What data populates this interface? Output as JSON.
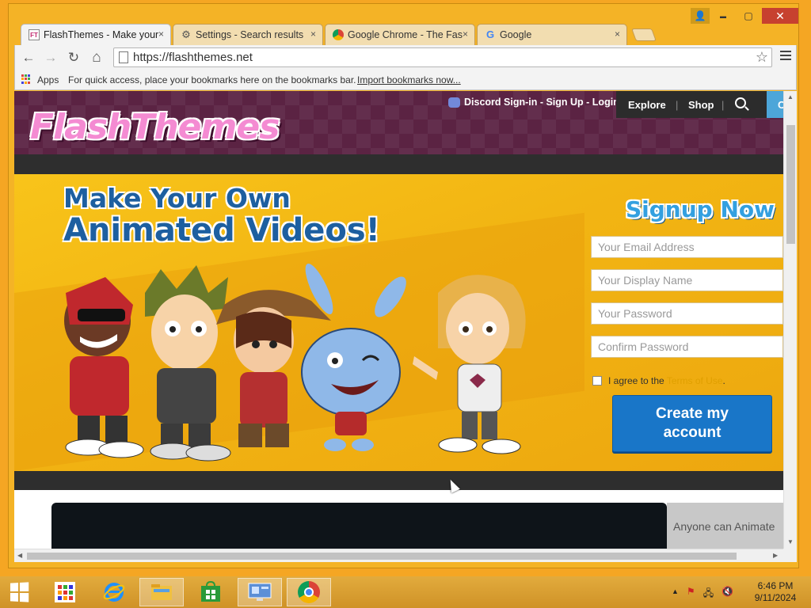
{
  "tabs": [
    {
      "label": "FlashThemes - Make your",
      "icon": "flashthemes-favicon",
      "close": "×"
    },
    {
      "label": "Settings - Search results",
      "icon": "gear-icon",
      "close": "×"
    },
    {
      "label": "Google Chrome - The Fas",
      "icon": "chrome-icon",
      "close": "×"
    },
    {
      "label": "Google",
      "icon": "google-icon",
      "close": "×"
    }
  ],
  "toolbar": {
    "url": "https://flashthemes.net",
    "back": "←",
    "forward": "→",
    "reload": "↻",
    "home": "⌂",
    "star": "☆"
  },
  "bookmarks": {
    "apps_label": "Apps",
    "hint": "For quick access, place your bookmarks here on the bookmarks bar.",
    "import_link": "Import bookmarks now..."
  },
  "site": {
    "logo": "FlashThemes",
    "discord_text": "Discord Sign-in - Sign Up - Login",
    "nav": {
      "explore": "Explore",
      "shop": "Shop",
      "sep": "|",
      "cta": "C"
    },
    "hero": {
      "line1": "Make Your Own",
      "line2": "Animated Videos!"
    },
    "signup": {
      "title": "Signup Now",
      "email_placeholder": "Your Email Address",
      "display_name_placeholder": "Your Display Name",
      "password_placeholder": "Your Password",
      "confirm_placeholder": "Confirm Password",
      "agree_prefix": "I agree to the",
      "terms_link": "Terms of Use",
      "agree_suffix": ".",
      "create_line1": "Create my",
      "create_line2": "account"
    },
    "video_side_text": "Anyone can Animate"
  },
  "window_controls": {
    "minimize": "▬",
    "maximize": "▢",
    "close": "✕",
    "user": "👤"
  },
  "taskbar": {
    "clock_time": "6:46 PM",
    "clock_date": "9/11/2024"
  },
  "colors": {
    "accent_orange": "#f2b513",
    "header_purple": "#5b2343",
    "button_blue": "#1976c8"
  }
}
